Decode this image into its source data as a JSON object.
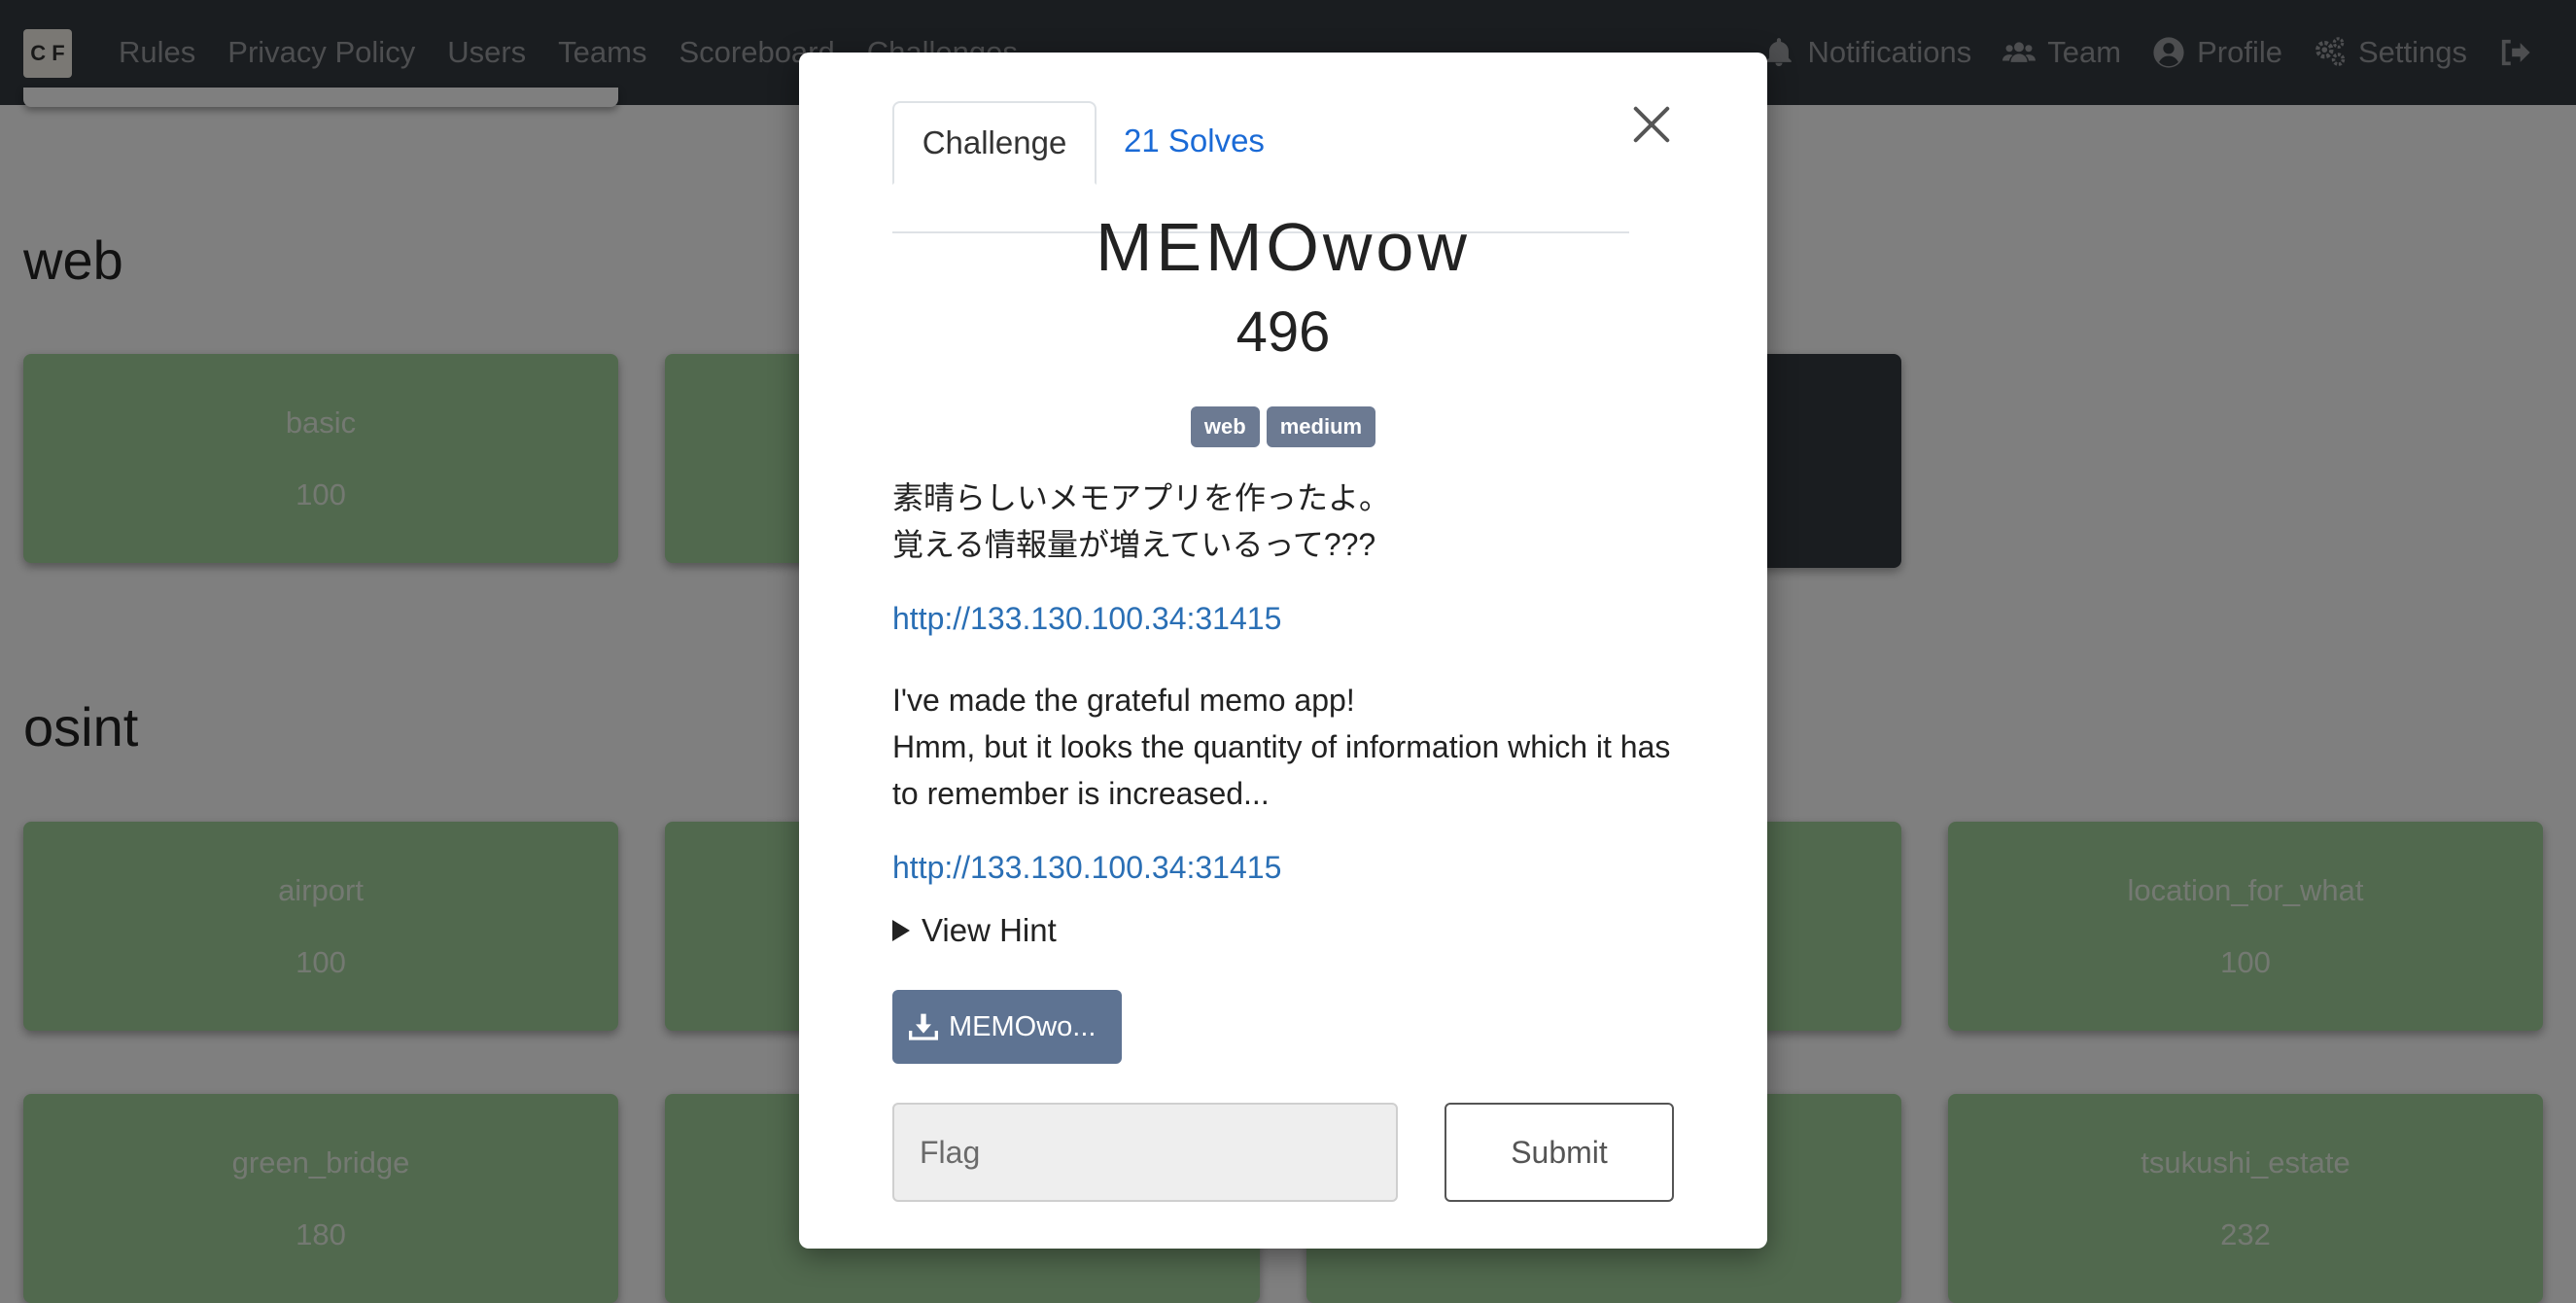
{
  "navbar": {
    "logo_text": "C F",
    "links": [
      "Rules",
      "Privacy Policy",
      "Users",
      "Teams",
      "Scoreboard",
      "Challenges"
    ],
    "right": [
      {
        "label": "Notifications",
        "icon": "bell-icon"
      },
      {
        "label": "Team",
        "icon": "users-icon"
      },
      {
        "label": "Profile",
        "icon": "user-circle-icon"
      },
      {
        "label": "Settings",
        "icon": "gears-icon"
      },
      {
        "label": "",
        "icon": "logout-icon"
      }
    ]
  },
  "categories": {
    "web": {
      "title": "web",
      "cards": [
        {
          "name": "basic",
          "value": "100"
        }
      ]
    },
    "osint": {
      "title": "osint",
      "cards": [
        {
          "name": "airport",
          "value": "100"
        },
        {
          "name": "location_for_what",
          "value": "100"
        },
        {
          "name": "green_bridge",
          "value": "180"
        },
        {
          "name": "tsukushi_estate",
          "value": "232"
        }
      ]
    }
  },
  "modal": {
    "tab_challenge": "Challenge",
    "tab_solves": "21 Solves",
    "title": "MEMOwow",
    "value": "496",
    "tags": [
      "web",
      "medium"
    ],
    "desc_jp_1": "素晴らしいメモアプリを作ったよ。",
    "desc_jp_2": "覚える情報量が増えているって???",
    "link1": "http://133.130.100.34:31415",
    "desc_en_1": "I've made the grateful memo app!",
    "desc_en_2": "Hmm, but it looks the quantity of information which it has to remember is increased...",
    "link2": "http://133.130.100.34:31415",
    "hint_label": "View Hint",
    "file_label": "MEMOwo...",
    "flag_placeholder": "Flag",
    "submit_label": "Submit"
  },
  "colors": {
    "navbar": "#343a40",
    "card": "#a3d39c",
    "tag": "#6c7a92",
    "file_button": "#5e7392",
    "link": "#2a6fb5"
  }
}
